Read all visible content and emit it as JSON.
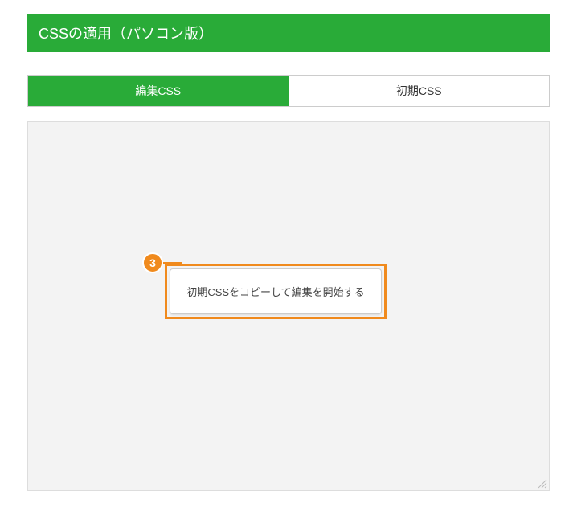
{
  "header": {
    "title": "CSSの適用（パソコン版）"
  },
  "tabs": [
    {
      "label": "編集CSS",
      "active": true
    },
    {
      "label": "初期CSS",
      "active": false
    }
  ],
  "step_badge": "3",
  "copy_button": {
    "label": "初期CSSをコピーして編集を開始する"
  }
}
